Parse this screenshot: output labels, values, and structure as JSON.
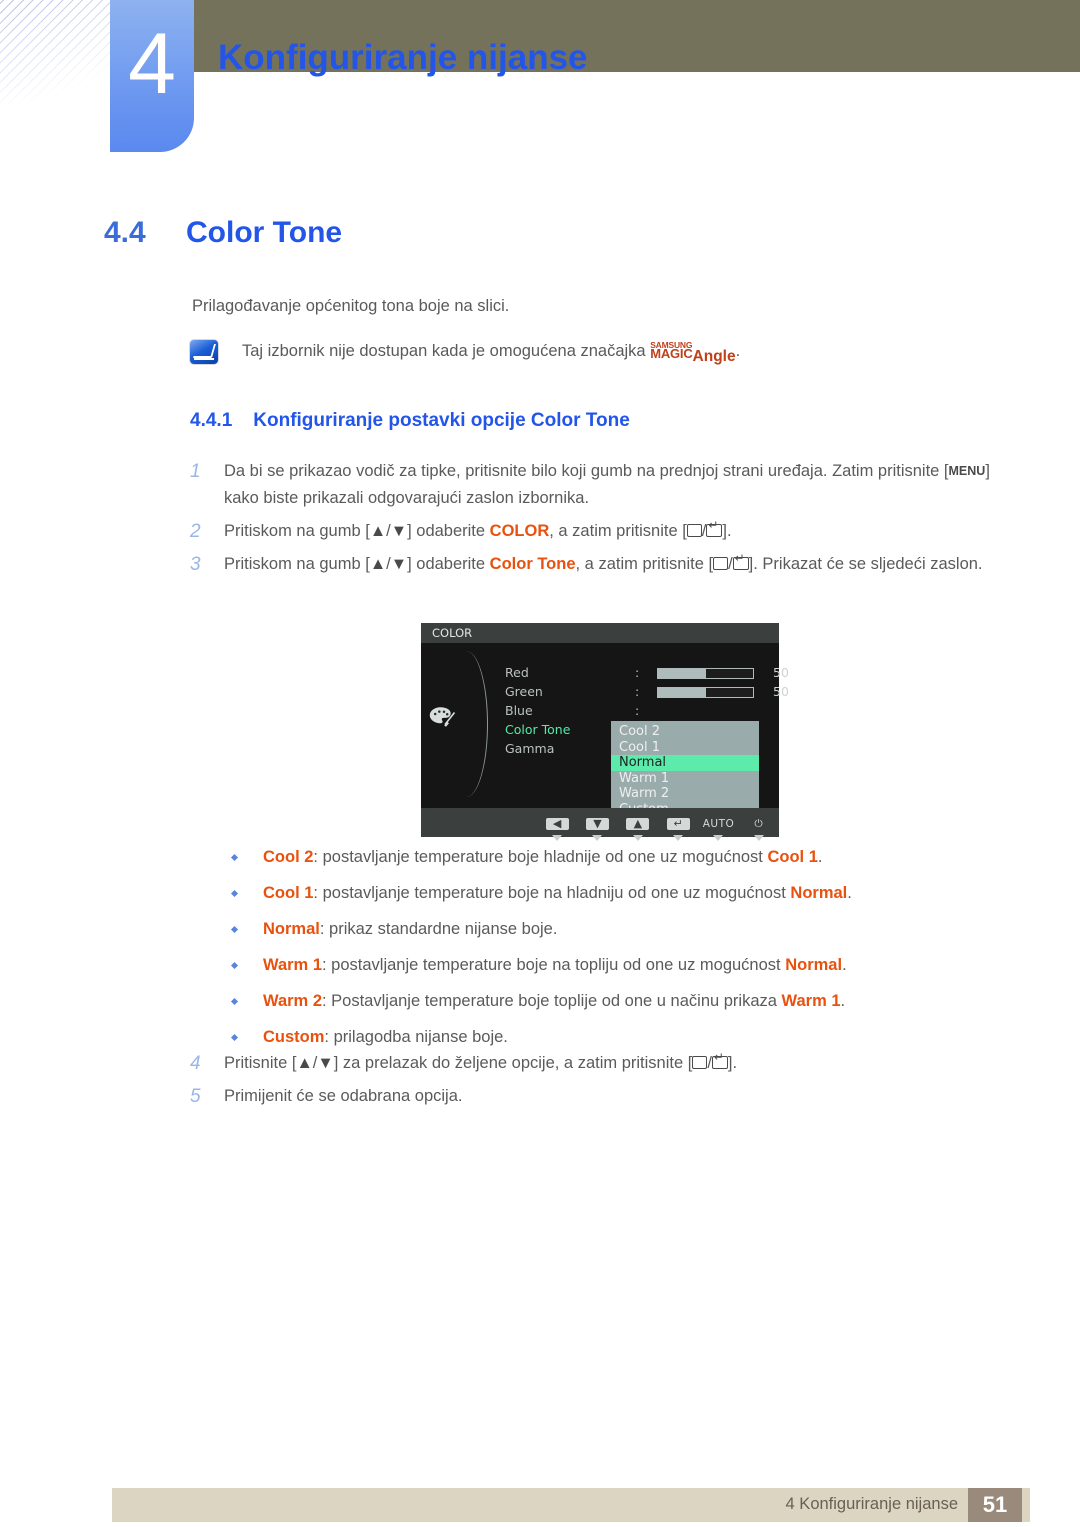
{
  "header": {
    "chapter_number": "4",
    "chapter_title": "Konfiguriranje nijanse"
  },
  "section": {
    "number": "4.4",
    "title": "Color Tone",
    "intro": "Prilagođavanje općenitog tona boje na slici."
  },
  "note": {
    "icon": "note-pen-icon",
    "text_before": "Taj izbornik nije dostupan kada je omogućena značajka ",
    "logo_top": "SAMSUNG",
    "logo_bottom": "MAGIC",
    "logo_suffix": "Angle",
    "text_after": "."
  },
  "subsection": {
    "number": "4.4.1",
    "title": "Konfiguriranje postavki opcije Color Tone"
  },
  "steps": [
    {
      "num": "1",
      "parts": [
        {
          "t": "text",
          "v": "Da bi se prikazao vodič za tipke, pritisnite bilo koji gumb na prednjoj strani uređaja. Zatim pritisnite ["
        },
        {
          "t": "menukey",
          "v": "MENU"
        },
        {
          "t": "text",
          "v": "] kako biste prikazali odgovarajući zaslon izbornika."
        }
      ]
    },
    {
      "num": "2",
      "parts": [
        {
          "t": "text",
          "v": "Pritiskom na gumb ["
        },
        {
          "t": "glyph",
          "v": "▲"
        },
        {
          "t": "text",
          "v": "/"
        },
        {
          "t": "glyph",
          "v": "▼"
        },
        {
          "t": "text",
          "v": "] odaberite "
        },
        {
          "t": "kw",
          "v": "COLOR"
        },
        {
          "t": "text",
          "v": ", a zatim pritisnite ["
        },
        {
          "t": "btnrect",
          "v": ""
        },
        {
          "t": "text",
          "v": "/"
        },
        {
          "t": "btnenter",
          "v": ""
        },
        {
          "t": "text",
          "v": "]."
        }
      ]
    },
    {
      "num": "3",
      "parts": [
        {
          "t": "text",
          "v": "Pritiskom na gumb ["
        },
        {
          "t": "glyph",
          "v": "▲"
        },
        {
          "t": "text",
          "v": "/"
        },
        {
          "t": "glyph",
          "v": "▼"
        },
        {
          "t": "text",
          "v": "] odaberite "
        },
        {
          "t": "kw",
          "v": "Color Tone"
        },
        {
          "t": "text",
          "v": ", a zatim pritisnite ["
        },
        {
          "t": "btnrect",
          "v": ""
        },
        {
          "t": "text",
          "v": "/"
        },
        {
          "t": "btnenter",
          "v": ""
        },
        {
          "t": "text",
          "v": "]. Prikazat će se sljedeći zaslon."
        }
      ]
    }
  ],
  "steps_tail": [
    {
      "num": "4",
      "parts": [
        {
          "t": "text",
          "v": "Pritisnite ["
        },
        {
          "t": "glyph",
          "v": "▲"
        },
        {
          "t": "text",
          "v": "/"
        },
        {
          "t": "glyph",
          "v": "▼"
        },
        {
          "t": "text",
          "v": "] za prelazak do željene opcije, a zatim pritisnite ["
        },
        {
          "t": "btnrect",
          "v": ""
        },
        {
          "t": "text",
          "v": "/"
        },
        {
          "t": "btnenter",
          "v": ""
        },
        {
          "t": "text",
          "v": "]."
        }
      ]
    },
    {
      "num": "5",
      "parts": [
        {
          "t": "text",
          "v": "Primijenit će se odabrana opcija."
        }
      ]
    }
  ],
  "bullets": [
    {
      "parts": [
        {
          "t": "kw",
          "v": "Cool 2"
        },
        {
          "t": "text",
          "v": ": postavljanje temperature boje hladnije od one uz mogućnost "
        },
        {
          "t": "kw",
          "v": "Cool 1"
        },
        {
          "t": "text",
          "v": "."
        }
      ]
    },
    {
      "parts": [
        {
          "t": "kw",
          "v": "Cool 1"
        },
        {
          "t": "text",
          "v": ": postavljanje temperature boje na hladniju od one uz mogućnost "
        },
        {
          "t": "kw",
          "v": "Normal"
        },
        {
          "t": "text",
          "v": "."
        }
      ]
    },
    {
      "parts": [
        {
          "t": "kw",
          "v": "Normal"
        },
        {
          "t": "text",
          "v": ": prikaz standardne nijanse boje."
        }
      ]
    },
    {
      "parts": [
        {
          "t": "kw",
          "v": "Warm 1"
        },
        {
          "t": "text",
          "v": ": postavljanje temperature boje na topliju od one uz mogućnost "
        },
        {
          "t": "kw",
          "v": "Normal"
        },
        {
          "t": "text",
          "v": "."
        }
      ]
    },
    {
      "parts": [
        {
          "t": "kw",
          "v": "Warm 2"
        },
        {
          "t": "text",
          "v": ": Postavljanje temperature boje toplije od one u načinu prikaza "
        },
        {
          "t": "kw",
          "v": "Warm 1"
        },
        {
          "t": "text",
          "v": "."
        }
      ]
    },
    {
      "parts": [
        {
          "t": "kw",
          "v": "Custom"
        },
        {
          "t": "text",
          "v": ": prilagodba nijanse boje."
        }
      ]
    }
  ],
  "osd": {
    "title": "COLOR",
    "category_icon": "color-palette-icon",
    "rows": [
      {
        "label": "Red",
        "colon": ":",
        "control": "slider",
        "value": "50",
        "fill_percent": 50,
        "selected": false
      },
      {
        "label": "Green",
        "colon": ":",
        "control": "slider",
        "value": "50",
        "fill_percent": 50,
        "selected": false
      },
      {
        "label": "Blue",
        "colon": ":",
        "control": "none",
        "value": "",
        "fill_percent": 0,
        "selected": false
      },
      {
        "label": "Color Tone",
        "colon": ":",
        "control": "none",
        "value": "",
        "fill_percent": 0,
        "selected": true
      },
      {
        "label": "Gamma",
        "colon": ":",
        "control": "none",
        "value": "",
        "fill_percent": 0,
        "selected": false
      }
    ],
    "dropdown": {
      "items": [
        "Cool 2",
        "Cool 1",
        "Normal",
        "Warm 1",
        "Warm 2",
        "Custom"
      ],
      "active": "Normal"
    },
    "buttons": [
      {
        "icon": "arrow-left-icon",
        "label": "◀",
        "is_text": false
      },
      {
        "icon": "arrow-down-icon",
        "label": "▼",
        "is_text": false
      },
      {
        "icon": "arrow-up-icon",
        "label": "▲",
        "is_text": false
      },
      {
        "icon": "enter-icon",
        "label": "↵",
        "is_text": false
      },
      {
        "icon": "auto-label",
        "label": "AUTO",
        "is_text": true
      },
      {
        "icon": "power-icon",
        "label": "⏻",
        "is_text": true
      }
    ]
  },
  "footer": {
    "text": "4 Konfiguriranje nijanse",
    "page": "51"
  },
  "colors": {
    "heading_blue": "#2255e8",
    "keyword_orange": "#e8520e",
    "olive_bar": "#75725c",
    "footer_bar": "#dcd5c1",
    "footer_page_box": "#9a8a7c",
    "osd_highlight_green": "#5cebab",
    "magic_logo": "#c0401a"
  }
}
